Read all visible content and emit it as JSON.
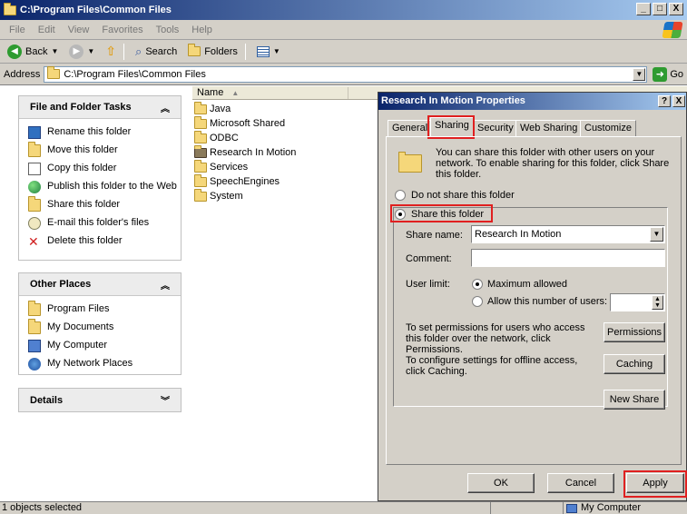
{
  "window": {
    "title": "C:\\Program Files\\Common Files",
    "minimize": "_",
    "maximize": "□",
    "close": "X"
  },
  "menu": [
    "File",
    "Edit",
    "View",
    "Favorites",
    "Tools",
    "Help"
  ],
  "toolbar": {
    "back": "Back",
    "search": "Search",
    "folders": "Folders"
  },
  "address": {
    "label": "Address",
    "value": "C:\\Program Files\\Common Files",
    "go": "Go"
  },
  "task_pane": {
    "file_folder_tasks": {
      "title": "File and Folder Tasks",
      "items": [
        "Rename this folder",
        "Move this folder",
        "Copy this folder",
        "Publish this folder to the Web",
        "Share this folder",
        "E-mail this folder's files",
        "Delete this folder"
      ]
    },
    "other_places": {
      "title": "Other Places",
      "items": [
        "Program Files",
        "My Documents",
        "My Computer",
        "My Network Places"
      ]
    },
    "details": {
      "title": "Details"
    }
  },
  "file_list": {
    "columns": [
      "Name"
    ],
    "items": [
      "Java",
      "Microsoft Shared",
      "ODBC",
      "Research In Motion",
      "Services",
      "SpeechEngines",
      "System"
    ]
  },
  "dialog": {
    "title": "Research In Motion Properties",
    "help": "?",
    "close": "X",
    "tabs": [
      "General",
      "Sharing",
      "Security",
      "Web Sharing",
      "Customize"
    ],
    "active_tab": "Sharing",
    "intro": "You can share this folder with other users on your network.  To enable sharing for this folder, click Share this folder.",
    "option_no_share": "Do not share this folder",
    "option_share": "Share this folder",
    "share_name_label": "Share name:",
    "share_name_value": "Research In Motion",
    "comment_label": "Comment:",
    "comment_value": "",
    "user_limit_label": "User limit:",
    "max_allowed": "Maximum allowed",
    "allow_number": "Allow this number of users:",
    "permissions_text": "To set permissions for users who access this folder over the network, click Permissions.",
    "permissions_btn": "Permissions",
    "caching_text": "To configure settings for offline access, click Caching.",
    "caching_btn": "Caching",
    "new_share_btn": "New Share",
    "ok": "OK",
    "cancel": "Cancel",
    "apply": "Apply"
  },
  "status": {
    "left": "1 objects selected",
    "right": "My Computer"
  },
  "colors": {
    "titlebar": "#0a246a",
    "highlight": "#e02020",
    "face": "#d4d0c8"
  }
}
